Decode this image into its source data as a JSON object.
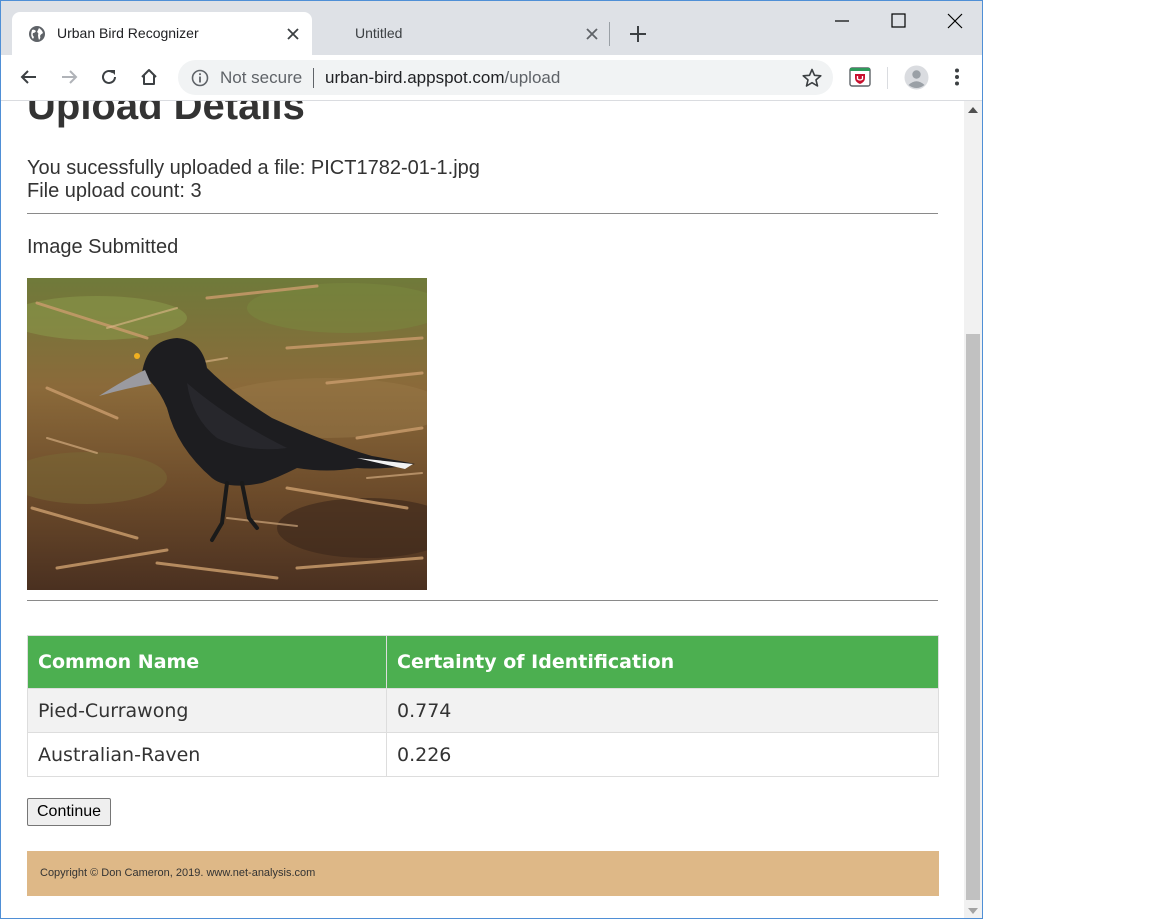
{
  "browser": {
    "tabs": [
      {
        "title": "Urban Bird Recognizer",
        "active": true
      },
      {
        "title": "Untitled",
        "active": false
      }
    ],
    "omnibox": {
      "security_label": "Not secure",
      "url_host": "urban-bird.appspot.com",
      "url_path": "/upload"
    }
  },
  "page": {
    "title": "Upload Details",
    "upload_message": "You sucessfully uploaded a file: PICT1782-01-1.jpg",
    "upload_count": "File upload count: 3",
    "image_label": "Image Submitted",
    "results_table": {
      "headers": [
        "Common Name",
        "Certainty of Identification"
      ],
      "rows": [
        [
          "Pied-Currawong",
          "0.774"
        ],
        [
          "Australian-Raven",
          "0.226"
        ]
      ]
    },
    "continue_label": "Continue",
    "footer_text": "Copyright © Don Cameron, 2019. www.net-analysis.com"
  },
  "colors": {
    "table_header": "#4caf50",
    "footer_bg": "#deb887",
    "tabstrip_bg": "#dee1e6",
    "window_border": "#4f8fd6"
  }
}
